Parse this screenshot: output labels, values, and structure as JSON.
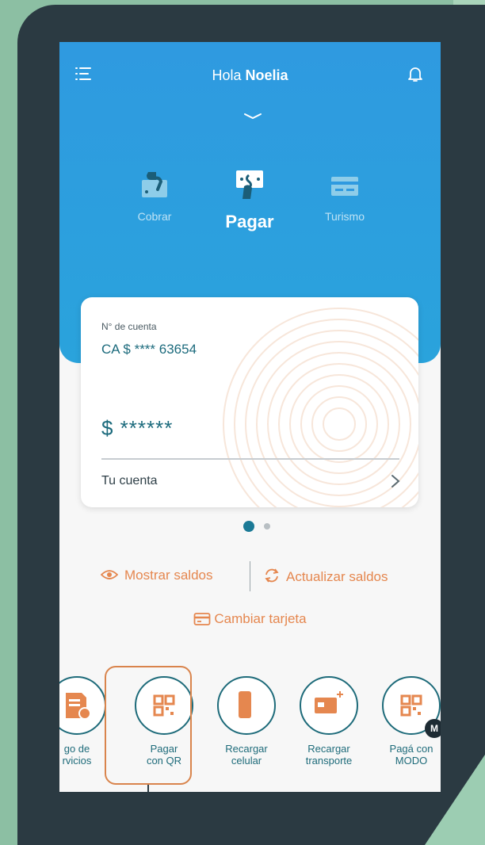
{
  "header": {
    "greeting_prefix": "Hola",
    "user_name": "Noelia"
  },
  "tabs": [
    {
      "label": "Cobrar",
      "icon": "hand-money-icon"
    },
    {
      "label": "Pagar",
      "icon": "pay-hand-icon",
      "active": true
    },
    {
      "label": "Turismo",
      "icon": "card-icon"
    }
  ],
  "account_card": {
    "label": "N° de cuenta",
    "account_number": "CA $ **** 63654",
    "balance": "$ ******",
    "footer_label": "Tu cuenta"
  },
  "pagination": {
    "total": 2,
    "active": 1
  },
  "actions": {
    "show_balance": "Mostrar saldos",
    "update_balance": "Actualizar saldos",
    "change_card": "Cambiar tarjeta"
  },
  "quick_actions": [
    {
      "line1": "go de",
      "line2": "rvicios",
      "icon": "bill-icon"
    },
    {
      "line1": "Pagar",
      "line2": "con QR",
      "icon": "qr-icon"
    },
    {
      "line1": "Recargar",
      "line2": "celular",
      "icon": "phone-plus-icon"
    },
    {
      "line1": "Recargar",
      "line2": "transporte",
      "icon": "transport-card-icon"
    },
    {
      "line1": "Pagá con",
      "line2": "MODO",
      "icon": "qr-modo-icon",
      "badge": "M"
    }
  ],
  "colors": {
    "header_blue": "#2f9ae0",
    "accent_orange": "#e5874f",
    "teal": "#1e6b7a",
    "frame": "#2b3a42"
  }
}
